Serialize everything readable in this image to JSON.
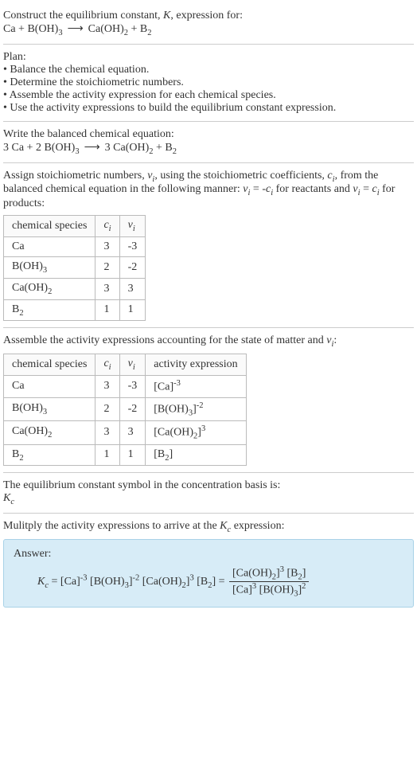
{
  "header": {
    "prompt_line": "Construct the equilibrium constant, K, expression for:",
    "equation_unbalanced": "Ca + B(OH)3  ⟶  Ca(OH)2 + B2"
  },
  "plan": {
    "title": "Plan:",
    "steps": [
      "Balance the chemical equation.",
      "Determine the stoichiometric numbers.",
      "Assemble the activity expression for each chemical species.",
      "Use the activity expressions to build the equilibrium constant expression."
    ]
  },
  "balanced": {
    "title": "Write the balanced chemical equation:",
    "equation": "3 Ca + 2 B(OH)3  ⟶  3 Ca(OH)2 + B2"
  },
  "stoich": {
    "intro": "Assign stoichiometric numbers, νi, using the stoichiometric coefficients, ci, from the balanced chemical equation in the following manner: νi = -ci for reactants and νi = ci for products:",
    "headers": [
      "chemical species",
      "ci",
      "νi"
    ],
    "rows": [
      {
        "species": "Ca",
        "ci": "3",
        "vi": "-3"
      },
      {
        "species": "B(OH)3",
        "ci": "2",
        "vi": "-2"
      },
      {
        "species": "Ca(OH)2",
        "ci": "3",
        "vi": "3"
      },
      {
        "species": "B2",
        "ci": "1",
        "vi": "1"
      }
    ]
  },
  "activities": {
    "intro": "Assemble the activity expressions accounting for the state of matter and νi:",
    "headers": [
      "chemical species",
      "ci",
      "νi",
      "activity expression"
    ],
    "rows": [
      {
        "species": "Ca",
        "ci": "3",
        "vi": "-3",
        "act": "[Ca]^-3"
      },
      {
        "species": "B(OH)3",
        "ci": "2",
        "vi": "-2",
        "act": "[B(OH)3]^-2"
      },
      {
        "species": "Ca(OH)2",
        "ci": "3",
        "vi": "3",
        "act": "[Ca(OH)2]^3"
      },
      {
        "species": "B2",
        "ci": "1",
        "vi": "1",
        "act": "[B2]"
      }
    ]
  },
  "symbol": {
    "line": "The equilibrium constant symbol in the concentration basis is:",
    "value": "Kc"
  },
  "multiply": {
    "line": "Mulitply the activity expressions to arrive at the Kc expression:"
  },
  "answer": {
    "label": "Answer:",
    "lhs": "Kc = [Ca]^-3 [B(OH)3]^-2 [Ca(OH)2]^3 [B2] =",
    "frac_num": "[Ca(OH)2]^3 [B2]",
    "frac_den": "[Ca]^3 [B(OH)3]^2"
  }
}
